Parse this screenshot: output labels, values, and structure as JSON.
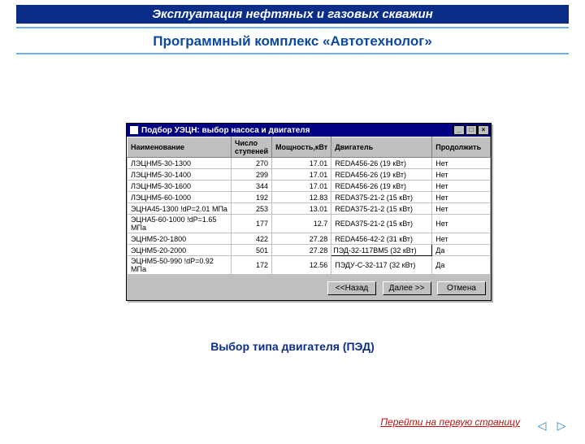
{
  "header": {
    "title": "Эксплуатация нефтяных и газовых скважин"
  },
  "subtitle": "Программный комплекс «Автотехнолог»",
  "window": {
    "title": "Подбор УЭЦН: выбор насоса и двигателя",
    "columns": {
      "name": "Наименование",
      "stages": "Число ступеней",
      "power": "Мощность,кВт",
      "motor": "Двигатель",
      "cont": "Продолжить"
    },
    "rows": [
      {
        "name": "ЛЭЦНМ5-30-1300",
        "stages": "270",
        "power": "17.01",
        "motor": "REDA456-26 (19 кВт)",
        "cont": "Нет"
      },
      {
        "name": "ЛЭЦНМ5-30-1400",
        "stages": "299",
        "power": "17.01",
        "motor": "REDA456-26 (19 кВт)",
        "cont": "Нет"
      },
      {
        "name": "ЛЭЦНМ5-30-1600",
        "stages": "344",
        "power": "17.01",
        "motor": "REDA456-26 (19 кВт)",
        "cont": "Нет"
      },
      {
        "name": "ЛЭЦНМ5-60-1000",
        "stages": "192",
        "power": "12.83",
        "motor": "REDA375-21-2 (15 кВт)",
        "cont": "Нет"
      },
      {
        "name": "ЭЦНА45-1300 !dP=2.01 МПа",
        "stages": "253",
        "power": "13.01",
        "motor": "REDA375-21-2 (15 кВт)",
        "cont": "Нет"
      },
      {
        "name": "ЭЦНА5-60-1000 !dP=1.65 МПа",
        "stages": "177",
        "power": "12.7",
        "motor": "REDA375-21-2 (15 кВт)",
        "cont": "Нет"
      },
      {
        "name": "ЭЦНМ5-20-1800",
        "stages": "422",
        "power": "27.28",
        "motor": "REDA456-42-2 (31 кВт)",
        "cont": "Нет"
      },
      {
        "name": "ЭЦНМ5-20-2000",
        "stages": "501",
        "power": "27.28",
        "motor": "ПЭД-32-117ВМ5 (32 кВт)",
        "cont": "Да",
        "editable": true
      },
      {
        "name": "ЭЦНМ5-50-990 !dP=0.92 МПа",
        "stages": "172",
        "power": "12.56",
        "motor": "ПЭДУ-С-32-117 (32 кВт)",
        "cont": "Да"
      }
    ],
    "buttons": {
      "back": "<<Назад",
      "next": "Далее >>",
      "cancel": "Отмена"
    }
  },
  "caption": "Выбор типа двигателя (ПЭД)",
  "footer": {
    "first_page": "Перейти на первую страницу"
  }
}
